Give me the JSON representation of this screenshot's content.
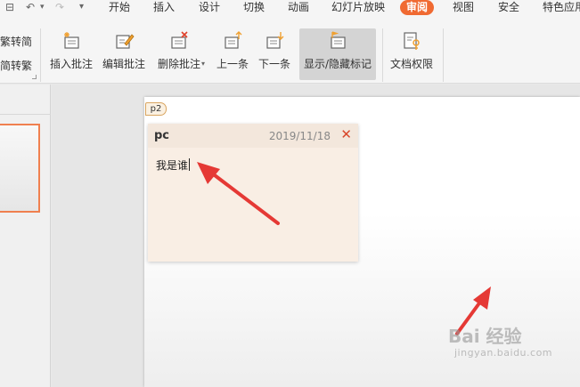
{
  "menubar": {
    "items": [
      "开始",
      "插入",
      "设计",
      "切换",
      "动画",
      "幻灯片放映",
      "审阅",
      "视图",
      "安全",
      "特色应用"
    ],
    "active_item": "审阅"
  },
  "ribbon": {
    "left_labels": [
      "繁转简",
      "简转繁"
    ],
    "buttons": [
      "插入批注",
      "编辑批注",
      "删除批注",
      "上一条",
      "下一条",
      "显示/隐藏标记",
      "文档权限"
    ],
    "pressed_button": "显示/隐藏标记"
  },
  "comment": {
    "marker": "p2",
    "author": "pc",
    "date": "2019/11/18",
    "close_glyph": "✕",
    "text": "我是谁"
  },
  "watermark": {
    "text": "Bai 经验",
    "subtext": "jingyan.baidu.com"
  },
  "colors": {
    "accent": "#f06a32",
    "arrow": "#e53935",
    "comment_bg": "#f9eee4"
  }
}
